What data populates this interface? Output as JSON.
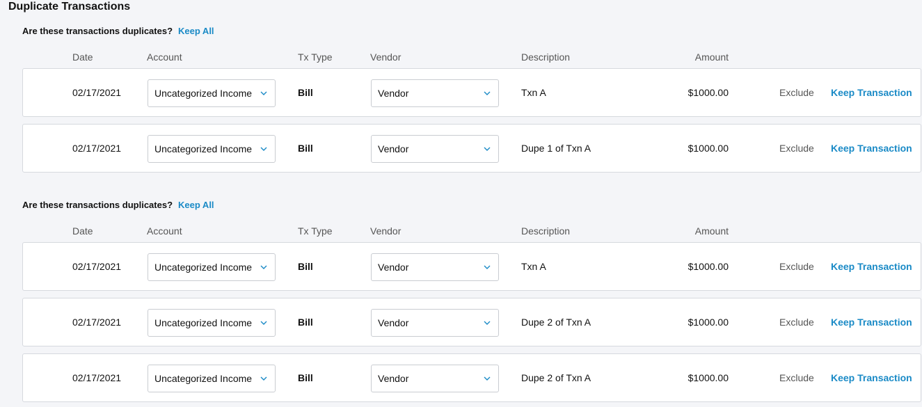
{
  "page_title": "Duplicate Transactions",
  "columns": {
    "date": "Date",
    "account": "Account",
    "tx_type": "Tx Type",
    "vendor": "Vendor",
    "description": "Description",
    "amount": "Amount"
  },
  "question": "Are these transactions duplicates?",
  "keep_all_label": "Keep All",
  "exclude_label": "Exclude",
  "keep_transaction_label": "Keep Transaction",
  "chevron_icon": "chevron-down-icon",
  "accent_color": "#1a8ac6",
  "groups": [
    {
      "rows": [
        {
          "date": "02/17/2021",
          "account": "Uncategorized Income",
          "tx_type": "Bill",
          "vendor": "Vendor",
          "description": "Txn A",
          "amount": "$1000.00"
        },
        {
          "date": "02/17/2021",
          "account": "Uncategorized Income",
          "tx_type": "Bill",
          "vendor": "Vendor",
          "description": "Dupe 1 of Txn A",
          "amount": "$1000.00"
        }
      ]
    },
    {
      "rows": [
        {
          "date": "02/17/2021",
          "account": "Uncategorized Income",
          "tx_type": "Bill",
          "vendor": "Vendor",
          "description": "Txn A",
          "amount": "$1000.00"
        },
        {
          "date": "02/17/2021",
          "account": "Uncategorized Income",
          "tx_type": "Bill",
          "vendor": "Vendor",
          "description": "Dupe 2 of Txn A",
          "amount": "$1000.00"
        },
        {
          "date": "02/17/2021",
          "account": "Uncategorized Income",
          "tx_type": "Bill",
          "vendor": "Vendor",
          "description": "Dupe 2 of Txn A",
          "amount": "$1000.00"
        }
      ]
    }
  ]
}
